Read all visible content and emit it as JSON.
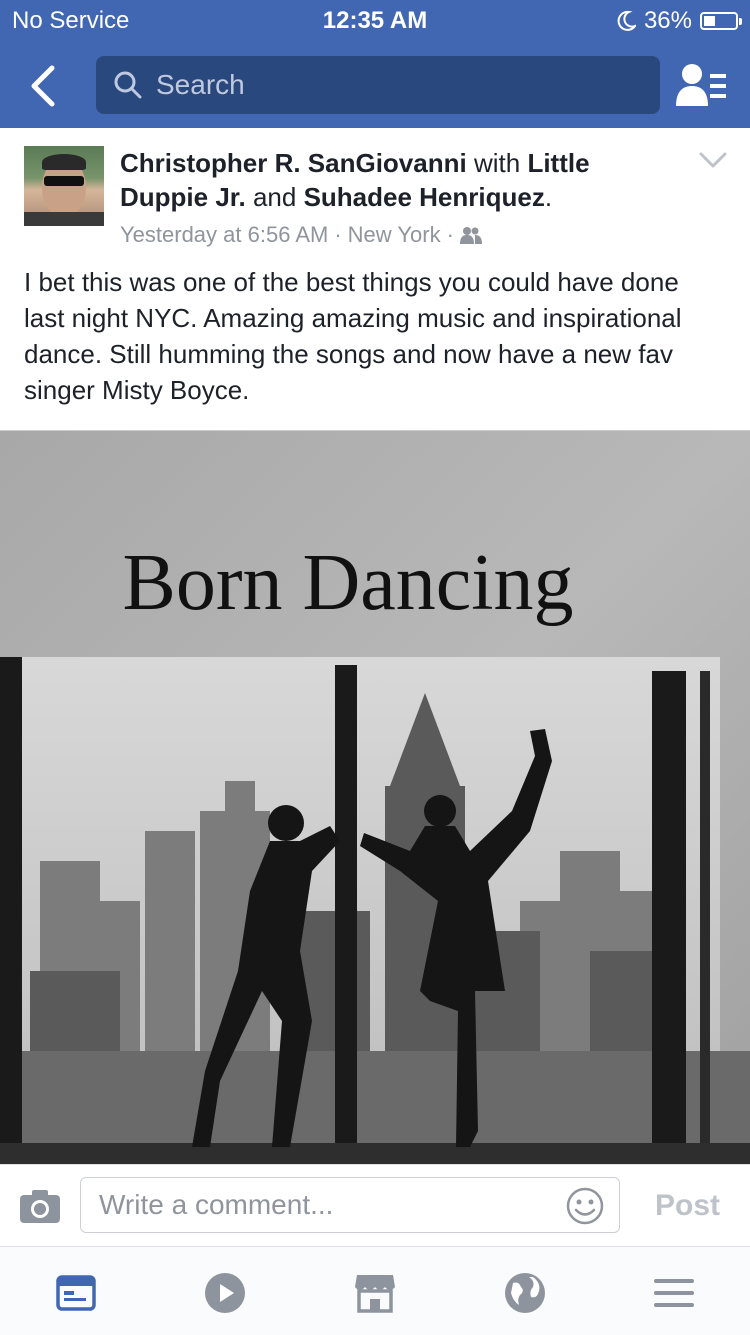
{
  "status_bar": {
    "carrier": "No Service",
    "time": "12:35 AM",
    "battery": "36%",
    "battery_level": 0.36
  },
  "navbar": {
    "search_placeholder": "Search"
  },
  "post": {
    "author": "Christopher R. SanGiovanni",
    "with_word": "with",
    "tagged_1": "Little Duppie Jr.",
    "and_word": "and",
    "tagged_2": "Suhadee Henriquez",
    "period": ".",
    "time": "Yesterday at 6:56 AM",
    "sep": "·",
    "location": "New York",
    "text": "I bet this was one of the best things you could have done last night NYC. Amazing amazing music and inspirational dance. Still humming the songs and now have a new fav singer Misty Boyce.",
    "photo_caption": "Born Dancing"
  },
  "comment": {
    "placeholder": "Write a comment...",
    "post_label": "Post"
  },
  "colors": {
    "brand": "#4267b2",
    "search_bg": "#29487d",
    "active_tab": "#4267b2",
    "inactive_tab": "#8d949e"
  }
}
